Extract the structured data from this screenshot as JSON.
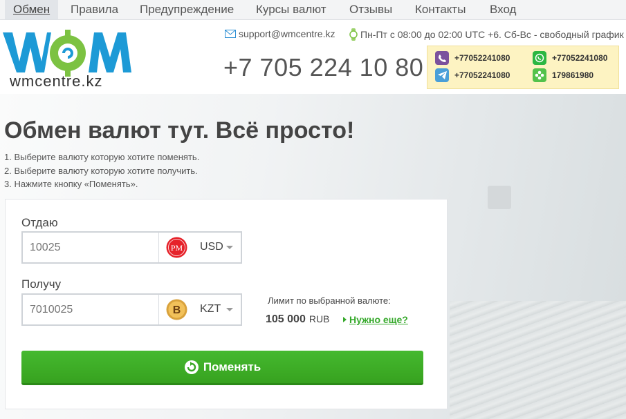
{
  "nav": {
    "items": [
      {
        "label": "Обмен",
        "active": true
      },
      {
        "label": "Правила"
      },
      {
        "label": "Предупреждение"
      },
      {
        "label": "Курсы валют"
      },
      {
        "label": "Отзывы"
      },
      {
        "label": "Контакты"
      },
      {
        "label": "Вход"
      }
    ]
  },
  "header": {
    "logo_text": "wmcentre.kz",
    "email": "support@wmcentre.kz",
    "hours": "Пн-Пт с 08:00 до 02:00 UTC +6. Сб-Вс - свободный график",
    "phone": "+7 705 224 10 80",
    "messengers": [
      {
        "name": "viber",
        "value": "+77052241080",
        "icon": "viber-icon",
        "color": "#7b519d"
      },
      {
        "name": "whatsapp",
        "value": "+77052241080",
        "icon": "whatsapp-icon",
        "color": "#2cb742"
      },
      {
        "name": "telegram",
        "value": "+77052241080",
        "icon": "telegram-icon",
        "color": "#4a9fd8"
      },
      {
        "name": "icq",
        "value": "179861980",
        "icon": "icq-flower-icon",
        "color": "#53c24b"
      }
    ]
  },
  "hero": {
    "title": "Обмен валют тут. Всё просто!",
    "steps": [
      "1. Выберите валюту которую хотите поменять.",
      "2. Выберите валюту которую хотите получить.",
      "3. Нажмите кнопку «Поменять»."
    ]
  },
  "form": {
    "give_label": "Отдаю",
    "give_placeholder": "10025",
    "give_currency": "USD",
    "give_currency_icon": "perfect-money-icon",
    "get_label": "Получу",
    "get_placeholder": "7010025",
    "get_currency": "KZT",
    "get_currency_icon": "bitcoin-icon",
    "limit_label": "Лимит по выбранной валюте:",
    "limit_amount": "105 000",
    "limit_unit": "RUB",
    "more_link": "Нужно еще?",
    "submit_label": "Поменять"
  },
  "colors": {
    "accent_green": "#3aa824",
    "logo_blue": "#1d9ad6",
    "logo_green": "#7cc242"
  }
}
